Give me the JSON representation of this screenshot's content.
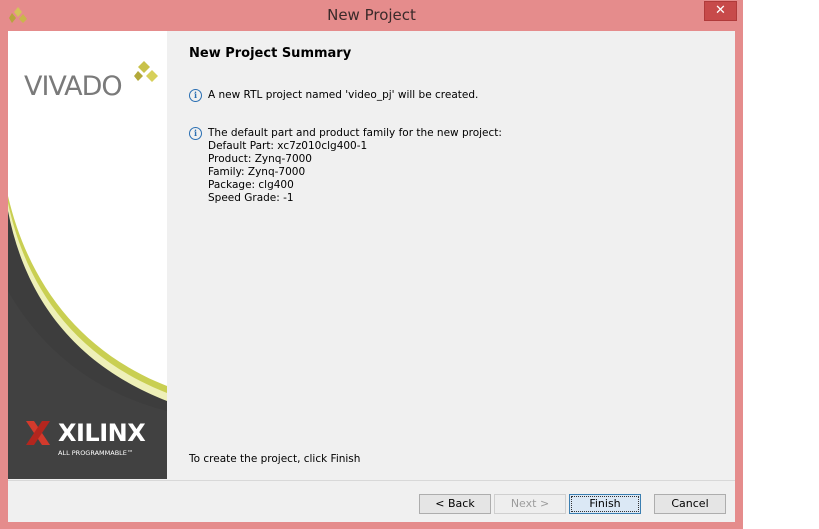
{
  "window": {
    "title": "New Project",
    "close_glyph": "✕"
  },
  "sidebar": {
    "vivado_logo": "VIVADO",
    "xilinx_logo": "XILINX",
    "xilinx_tagline": "ALL PROGRAMMABLE™"
  },
  "main": {
    "heading": "New Project Summary",
    "info_icon_glyph": "i",
    "info1": "A new RTL project named 'video_pj' will be created.",
    "info2": {
      "line1": "The default part and product family for the new project:",
      "line2": "Default Part: xc7z010clg400-1",
      "line3": "Product: Zynq-7000",
      "line4": "Family: Zynq-7000",
      "line5": "Package: clg400",
      "line6": "Speed Grade: -1"
    },
    "finish_hint": "To create the project, click Finish"
  },
  "buttons": {
    "back": "< Back",
    "next": "Next >",
    "finish": "Finish",
    "cancel": "Cancel"
  },
  "icons": {
    "title": "vivado-app-icon",
    "info": "info-icon",
    "close": "close-icon"
  }
}
